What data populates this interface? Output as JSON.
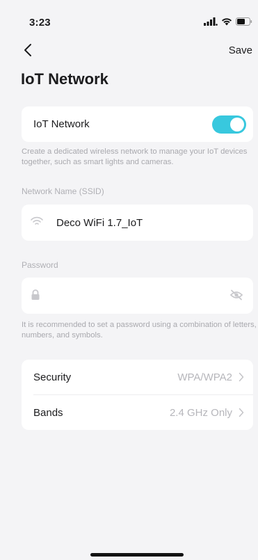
{
  "status": {
    "time": "3:23"
  },
  "nav": {
    "save_label": "Save"
  },
  "page": {
    "title": "IoT Network"
  },
  "iot_toggle": {
    "label": "IoT Network",
    "enabled": true,
    "hint": "Create a dedicated wireless network to manage your IoT devices together, such as smart lights and cameras."
  },
  "ssid": {
    "section_label": "Network Name (SSID)",
    "value": "Deco WiFi 1.7_IoT",
    "icon": "wifi-icon"
  },
  "password": {
    "section_label": "Password",
    "value": "",
    "icon": "lock-icon",
    "visibility_icon": "eye-off-icon",
    "hint": "It is recommended to set a password using a combination of letters, numbers, and symbols."
  },
  "settings": {
    "items": [
      {
        "label": "Security",
        "value": "WPA/WPA2"
      },
      {
        "label": "Bands",
        "value": "2.4 GHz Only"
      }
    ]
  },
  "colors": {
    "background": "#f4f4f6",
    "card": "#ffffff",
    "accent": "#38c8de",
    "muted_text": "#a9a9ae"
  }
}
